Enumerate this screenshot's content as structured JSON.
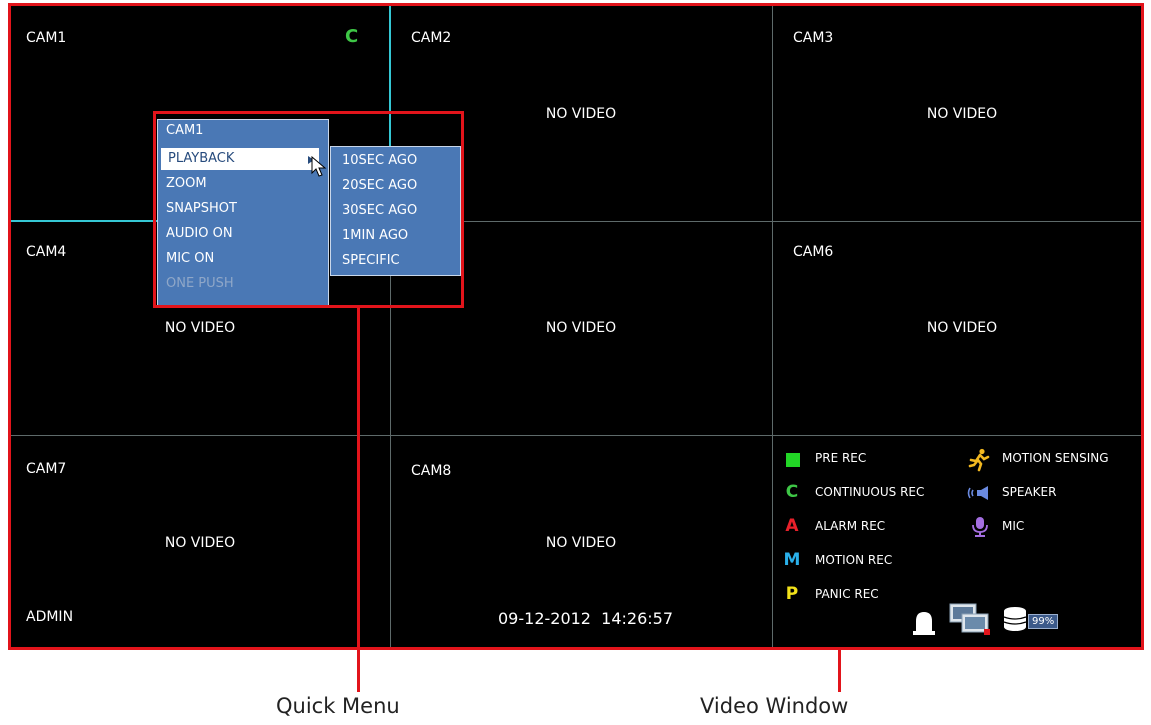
{
  "cameras": [
    {
      "label": "CAM1",
      "status": "",
      "rec_mark": "C"
    },
    {
      "label": "CAM2",
      "status": "NO VIDEO"
    },
    {
      "label": "CAM3",
      "status": "NO VIDEO"
    },
    {
      "label": "CAM4",
      "status": "NO VIDEO"
    },
    {
      "label": "",
      "status": "NO VIDEO"
    },
    {
      "label": "CAM6",
      "status": "NO VIDEO"
    },
    {
      "label": "CAM7",
      "status": "NO VIDEO"
    },
    {
      "label": "CAM8",
      "status": "NO VIDEO"
    }
  ],
  "user": "ADMIN",
  "datetime": "09-12-2012  14:26:57",
  "quick_menu": {
    "title": "CAM1",
    "items": [
      "PLAYBACK",
      "ZOOM",
      "SNAPSHOT",
      "AUDIO ON",
      "MIC ON",
      "ONE PUSH"
    ],
    "disabled_item": "ONE PUSH",
    "selected_item": "PLAYBACK"
  },
  "playback_submenu": {
    "items": [
      "10SEC AGO",
      "20SEC AGO",
      "30SEC AGO",
      "1MIN AGO",
      "SPECIFIC"
    ]
  },
  "legend": {
    "left": [
      {
        "icon": "■",
        "label": "PRE REC",
        "color": "#22d626"
      },
      {
        "icon": "C",
        "label": "CONTINUOUS REC",
        "color": "#3ec646"
      },
      {
        "icon": "A",
        "label": "ALARM REC",
        "color": "#e8202a"
      },
      {
        "icon": "M",
        "label": "MOTION REC",
        "color": "#2ab0ea"
      },
      {
        "icon": "P",
        "label": "PANIC REC",
        "color": "#f2e21a"
      }
    ],
    "right": [
      {
        "icon": "running-person-icon",
        "label": "MOTION SENSING",
        "color": "#f2b820"
      },
      {
        "icon": "speaker-icon",
        "label": "SPEAKER",
        "color": "#6a8ae0"
      },
      {
        "icon": "mic-icon",
        "label": "MIC",
        "color": "#a46ee0"
      }
    ]
  },
  "status_icons": {
    "hdd_percent": "99%"
  },
  "callouts": {
    "quick_menu": "Quick Menu",
    "video_window": "Video Window"
  }
}
